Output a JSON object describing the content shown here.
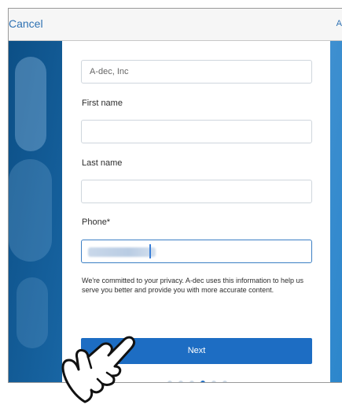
{
  "nav": {
    "cancel_label": "Cancel",
    "right_label": "A"
  },
  "form": {
    "company_value": "A-dec, Inc",
    "first_name_label": "First name",
    "first_name_value": "",
    "last_name_label": "Last name",
    "last_name_value": "",
    "phone_label": "Phone*",
    "phone_value_obscured": true,
    "privacy_text": "We're committed to your privacy. A-dec uses this information to help us serve you better and provide you with more accurate content.",
    "next_label": "Next"
  },
  "pagination": {
    "total_pages": 6,
    "current_page": 4
  },
  "colors": {
    "accent": "#1d6dc3",
    "nav_text": "#2f72b3",
    "background_blue": "#1f72b4"
  },
  "icons": {
    "pointer_hand": "pointer-hand-icon"
  }
}
